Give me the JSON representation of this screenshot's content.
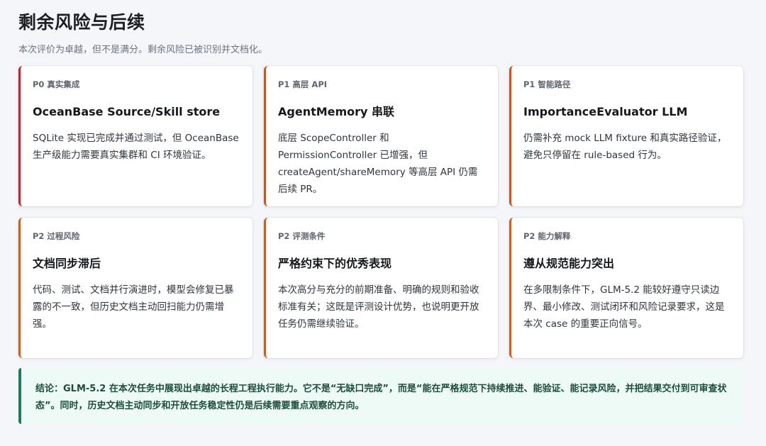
{
  "header": {
    "title": "剩余风险与后续",
    "subtitle": "本次评价为卓越，但不是满分。剩余风险已被识别并文档化。"
  },
  "cards": [
    {
      "tag": "P0 真实集成",
      "title": "OceanBase Source/Skill store",
      "body": "SQLite 实现已完成并通过测试，但 OceanBase 生产级能力需要真实集群和 CI 环境验证。"
    },
    {
      "tag": "P1 高层 API",
      "title": "AgentMemory 串联",
      "body": "底层 ScopeController 和 PermissionController 已增强，但 createAgent/shareMemory 等高层 API 仍需后续 PR。"
    },
    {
      "tag": "P1 智能路径",
      "title": "ImportanceEvaluator LLM",
      "body": "仍需补充 mock LLM fixture 和真实路径验证，避免只停留在 rule-based 行为。"
    },
    {
      "tag": "P2 过程风险",
      "title": "文档同步滞后",
      "body": "代码、测试、文档并行演进时，模型会修复已暴露的不一致，但历史文档主动回扫能力仍需增强。"
    },
    {
      "tag": "P2 评测条件",
      "title": "严格约束下的优秀表现",
      "body": "本次高分与充分的前期准备、明确的规则和验收标准有关；这既是评测设计优势，也说明更开放任务仍需继续验证。"
    },
    {
      "tag": "P2 能力解释",
      "title": "遵从规范能力突出",
      "body": "在多限制条件下，GLM-5.2 能较好遵守只读边界、最小修改、测试闭环和风险记录要求，这是本次 case 的重要正向信号。"
    }
  ],
  "conclusion": {
    "text": "结论：GLM-5.2 在本次任务中展现出卓越的长程工程执行能力。它不是“无缺口完成”，而是“能在严格规范下持续推进、能验证、能记录风险，并把结果交付到可审查状态”。同时，历史文档主动同步和开放任务稳定性仍是后续需要重点观察的方向。"
  },
  "colors": {
    "p0_accent": "#b8282f",
    "p1_accent": "#c4572a",
    "p2_accent": "#c2622a",
    "conclusion_accent": "#1f7a5a",
    "conclusion_bg": "#eefaf5"
  }
}
